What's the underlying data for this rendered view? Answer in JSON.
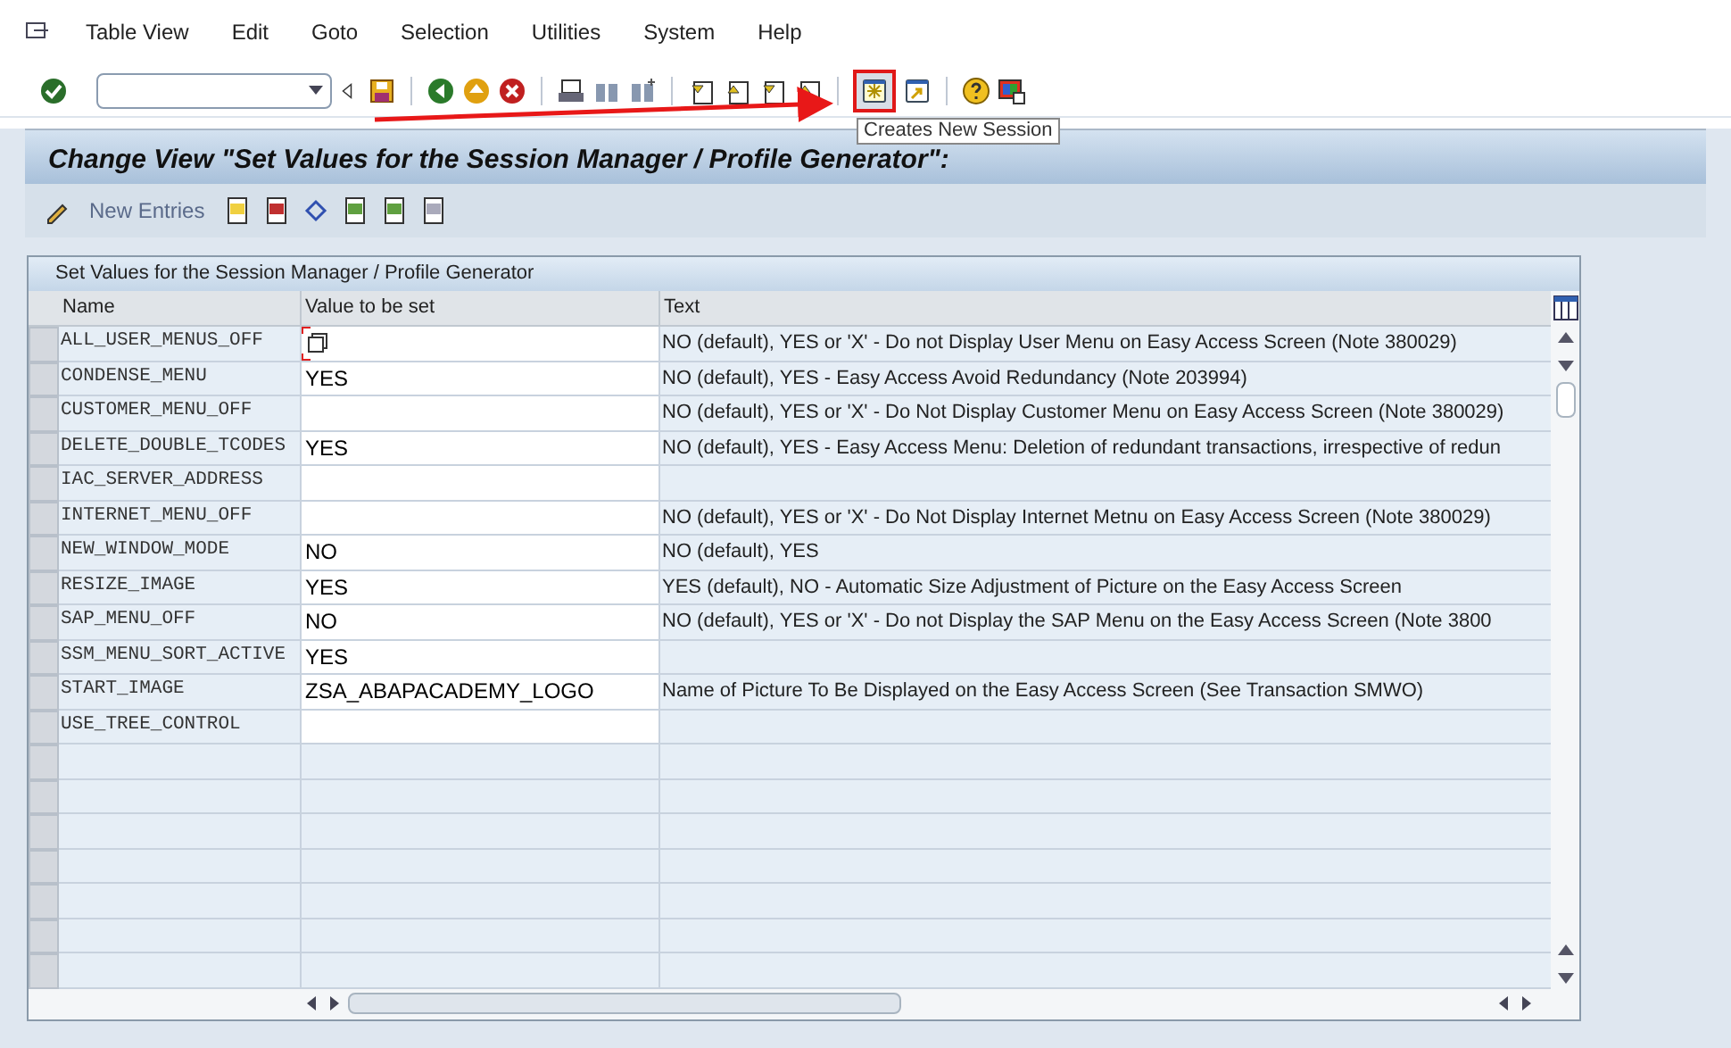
{
  "menu": [
    {
      "label": "Table View"
    },
    {
      "label": "Edit"
    },
    {
      "label": "Goto"
    },
    {
      "label": "Selection"
    },
    {
      "label": "Utilities"
    },
    {
      "label": "System"
    },
    {
      "label": "Help"
    }
  ],
  "tooltip": "Creates New Session",
  "title": "Change View \"Set Values for the Session Manager / Profile Generator\":",
  "app_toolbar": {
    "new_entries": "New Entries"
  },
  "table": {
    "title": "Set Values for the Session Manager / Profile Generator",
    "columns": [
      "Name",
      "Value to be set",
      "Text"
    ],
    "rows": [
      {
        "name": "ALL_USER_MENUS_OFF",
        "value": "",
        "text": "NO (default), YES or 'X'   - Do not Display User Menu on Easy Access Screen (Note 380029)",
        "focused": true
      },
      {
        "name": "CONDENSE_MENU",
        "value": "YES",
        "text": "NO (default), YES - Easy Access Avoid Redundancy (Note 203994)",
        "focused": false
      },
      {
        "name": "CUSTOMER_MENU_OFF",
        "value": "",
        "text": "NO (default), YES or 'X' - Do Not Display Customer Menu on Easy Access Screen  (Note 380029)",
        "focused": false
      },
      {
        "name": "DELETE_DOUBLE_TCODES",
        "value": "YES",
        "text": "NO (default), YES - Easy Access Menu: Deletion of redundant transactions, irrespective of redun",
        "focused": false
      },
      {
        "name": "IAC_SERVER_ADDRESS",
        "value": "",
        "text": "",
        "focused": false
      },
      {
        "name": "INTERNET_MENU_OFF",
        "value": "",
        "text": "NO (default), YES or 'X' - Do Not Display Internet Metnu on Easy Access Screen  (Note 380029)",
        "focused": false
      },
      {
        "name": "NEW_WINDOW_MODE",
        "value": "NO",
        "text": "NO (default), YES",
        "focused": false
      },
      {
        "name": "RESIZE_IMAGE",
        "value": "YES",
        "text": "YES (default), NO - Automatic Size Adjustment of Picture on the Easy Access Screen",
        "focused": false
      },
      {
        "name": "SAP_MENU_OFF",
        "value": "NO",
        "text": "NO (default), YES or 'X' -  Do not Display the SAP Menu on the Easy Access Screen (Note 3800",
        "focused": false
      },
      {
        "name": "SSM_MENU_SORT_ACTIVE",
        "value": "YES",
        "text": "",
        "focused": false
      },
      {
        "name": "START_IMAGE",
        "value": "ZSA_ABAPACADEMY_LOGO",
        "text": "Name of Picture To Be Displayed on the Easy Access Screen (See Transaction SMWO)",
        "focused": false
      },
      {
        "name": "USE_TREE_CONTROL",
        "value": "",
        "text": "",
        "focused": false
      }
    ]
  }
}
